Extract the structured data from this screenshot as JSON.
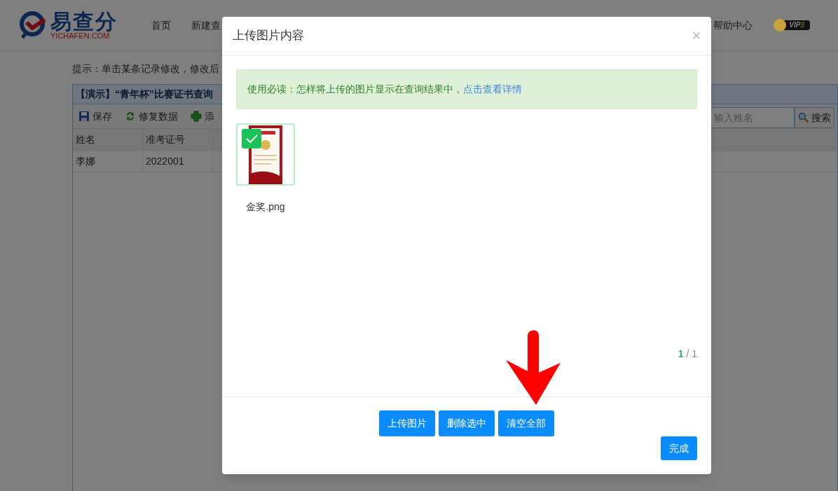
{
  "header": {
    "logo": {
      "name": "易查分",
      "domain": "YICHAFEN.COM"
    },
    "nav": [
      "首页",
      "新建查"
    ],
    "help": "帮助中心",
    "vip": {
      "label": "VIP",
      "level": "3"
    }
  },
  "hint": "提示：单击某条记录修改，修改后",
  "panel": {
    "title": "【演示】“青年杯”比赛证书查询",
    "toolbar": [
      {
        "kind": "save",
        "label": "保存"
      },
      {
        "kind": "repair",
        "label": "修复数据"
      },
      {
        "kind": "add",
        "label": "添"
      }
    ],
    "search": {
      "placeholder": "输入姓名",
      "button": "搜索"
    },
    "columns": [
      "姓名",
      "准考证号"
    ],
    "rows": [
      [
        "李娜",
        "2022001"
      ]
    ]
  },
  "dialog": {
    "title": "上传图片内容",
    "close": "×",
    "notice": {
      "text": "使用必读：怎样将上传的图片显示在查询结果中，",
      "link": "点击查看详情"
    },
    "images": [
      {
        "name": "金奖.png",
        "selected": true
      }
    ],
    "pager": {
      "current": "1",
      "separator": "/",
      "total": "1"
    },
    "buttons": [
      "上传图片",
      "删除选中",
      "清空全部"
    ],
    "done": "完成"
  }
}
